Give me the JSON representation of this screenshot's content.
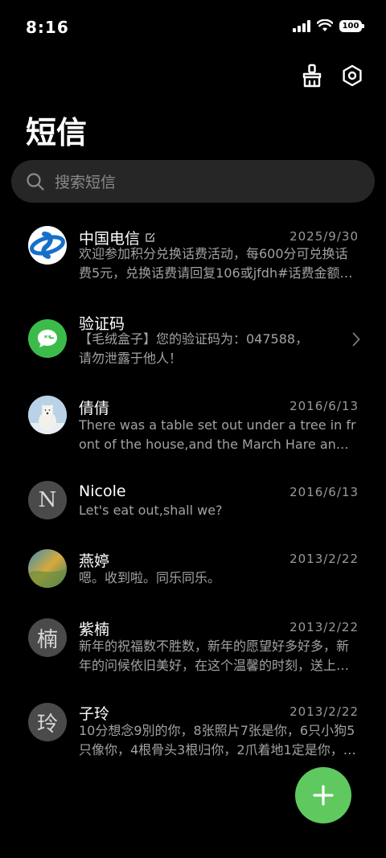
{
  "status_bar": {
    "time": "8:16",
    "battery": "100"
  },
  "header": {
    "title": "短信",
    "actions": [
      {
        "name": "clean-icon"
      },
      {
        "name": "settings-icon"
      }
    ]
  },
  "search": {
    "placeholder": "搜索短信",
    "icon": "search-icon"
  },
  "conversations": [
    {
      "name": "中国电信",
      "name_badge": "edit-icon",
      "date": "2025/9/30",
      "preview": "欢迎参加积分兑换话费活动，每600分可兑换话费5元，兑换话费请回复106或jfdh#话费金额…",
      "avatar": "china-telecom-logo"
    },
    {
      "name": "验证码",
      "date": "",
      "preview": "【毛绒盒子】您的验证码为：047588，请勿泄露于他人！",
      "avatar": "message-bubble-icon",
      "accent": "#3dbb4a"
    },
    {
      "name": "倩倩",
      "date": "2016/6/13",
      "preview": "There was a table set out under a tree in front of the house,and the March Hare an…",
      "avatar": "polar-bear-photo"
    },
    {
      "name": "Nicole",
      "date": "2016/6/13",
      "preview": "Let's eat out,shall we?",
      "avatar_letter": "N"
    },
    {
      "name": "燕婷",
      "date": "2013/2/22",
      "preview": "嗯。收到啦。同乐同乐。",
      "avatar": "landscape-photo"
    },
    {
      "name": "紫楠",
      "date": "2013/2/22",
      "preview": "新年的祝福数不胜数，新年的愿望好多好多，新年的问候依旧美好，在这个温馨的时刻，送上…",
      "avatar_letter": "楠"
    },
    {
      "name": "子玲",
      "date": "2013/2/22",
      "preview": "10分想念9別的你，8张照片7张是你，6只小狗5只像你，4根骨头3根归你，2爪着地1定是你，…",
      "avatar_letter": "玲"
    }
  ],
  "fab": {
    "icon": "plus-icon",
    "color": "#5fc95f"
  }
}
